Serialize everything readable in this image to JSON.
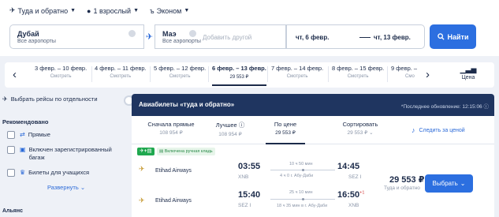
{
  "search": {
    "trip_type": "Туда и обратно",
    "passengers": "1 взрослый",
    "cabin": "Эконом",
    "from_city": "Дубай",
    "from_sub": "Все аэропорты",
    "to_city": "Маэ",
    "to_sub": "Все аэропорты",
    "add_other_placeholder": "Добавить другой",
    "depart_date": "чт, 6 февр.",
    "return_date": "чт, 13 февр.",
    "find_label": "Найти"
  },
  "date_strip": {
    "items": [
      {
        "label": "3 февр. – 10 февр.",
        "sub": "Смотреть"
      },
      {
        "label": "4 февр. – 11 февр.",
        "sub": "Смотреть"
      },
      {
        "label": "5 февр. – 12 февр.",
        "sub": "Смотреть"
      },
      {
        "label": "6 февр. – 13 февр.",
        "sub": "29 553 ₽"
      },
      {
        "label": "7 февр. – 14 февр.",
        "sub": "Смотреть"
      },
      {
        "label": "8 февр. – 15 февр.",
        "sub": "Смотреть"
      },
      {
        "label": "9 февр. –",
        "sub": "Смо"
      }
    ],
    "price_tab": "Цена"
  },
  "sidebar": {
    "separate_flights": "Выбрать рейсы по отдельности",
    "recommended_heading": "Рекомендовано",
    "filters": [
      {
        "label": "Прямые"
      },
      {
        "label": "Включен зарегистрированный багаж"
      },
      {
        "label": "Билеты для учащихся"
      }
    ],
    "expand": "Развернуть",
    "alliance": "Альянс"
  },
  "results": {
    "title": "Авиабилеты «туда и обратно»",
    "updated": "*Последнее обновление: 12:15:06",
    "sort_tabs": [
      {
        "label": "Сначала прямые",
        "sub": "108 954 ₽"
      },
      {
        "label": "Лучшее",
        "sub": "108 954 ₽"
      },
      {
        "label": "По цене",
        "sub": "29 553 ₽"
      },
      {
        "label": "Сортировать",
        "sub": "29 553 ₽"
      }
    ],
    "follow_prices": "Следить за ценой"
  },
  "card": {
    "tag": "✈+▤",
    "bag_tag": "Включена ручная кладь",
    "outbound": {
      "airline": "Etihad Airways",
      "dep_time": "03:55",
      "dep_airport": "XNB",
      "duration": "10 ч 50 мин",
      "stop": "4 ч 0 г. Абу-Даби",
      "arr_time": "14:45",
      "arr_airport": "SEZ I"
    },
    "inbound": {
      "airline": "Etihad Airways",
      "dep_time": "15:40",
      "dep_airport": "SEZ I",
      "duration": "25 ч 10 мин",
      "stop": "18 ч 35 мин в г. Абу-Даби",
      "arr_time": "16:50",
      "arr_plus": "+1",
      "arr_airport": "XNB"
    },
    "price": "29 553 ₽",
    "price_sub": "Туда и обратно",
    "select_label": "Выбрать"
  },
  "colors": {
    "accent": "#2c6fe0",
    "header_dark": "#1f3560",
    "background": "#eef1f7"
  }
}
